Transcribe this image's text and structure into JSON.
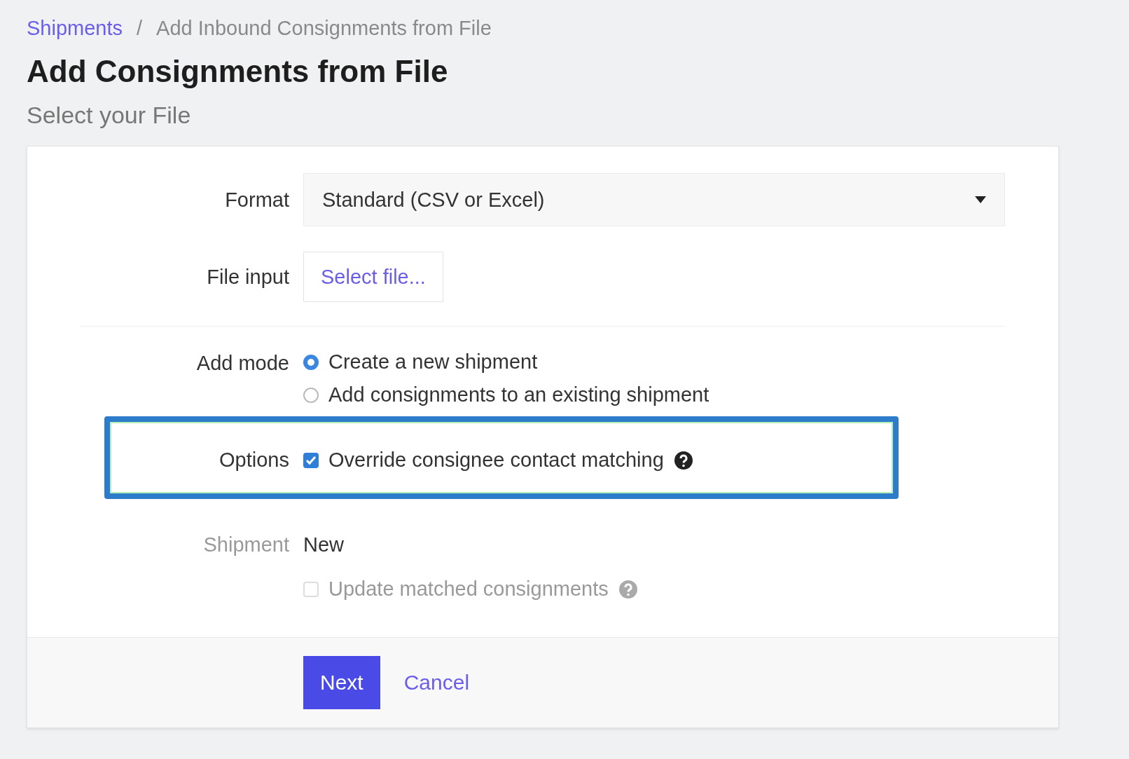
{
  "breadcrumb": [
    {
      "label": "Shipments",
      "link": true
    },
    {
      "label": "Add Inbound Consignments from File",
      "link": false
    }
  ],
  "separator": "/",
  "title": "Add Consignments from File",
  "subtitle": "Select your File",
  "form": {
    "format": {
      "label": "Format",
      "value": "Standard (CSV or Excel)"
    },
    "file_input": {
      "label": "File input",
      "button": "Select file..."
    },
    "add_mode": {
      "label": "Add mode",
      "options": [
        {
          "label": "Create a new shipment",
          "selected": true
        },
        {
          "label": "Add consignments to an existing shipment",
          "selected": false
        }
      ]
    },
    "options": {
      "label": "Options",
      "highlighted": true,
      "items": [
        {
          "label": "Override consignee contact matching",
          "checked": true,
          "disabled": false,
          "help": true
        }
      ]
    },
    "shipment": {
      "label": "Shipment",
      "value": "New",
      "disabled": true
    },
    "update": {
      "label": "Update matched consignments",
      "checked": false,
      "disabled": true,
      "help": true
    }
  },
  "actions": {
    "primary": "Next",
    "secondary": "Cancel"
  }
}
